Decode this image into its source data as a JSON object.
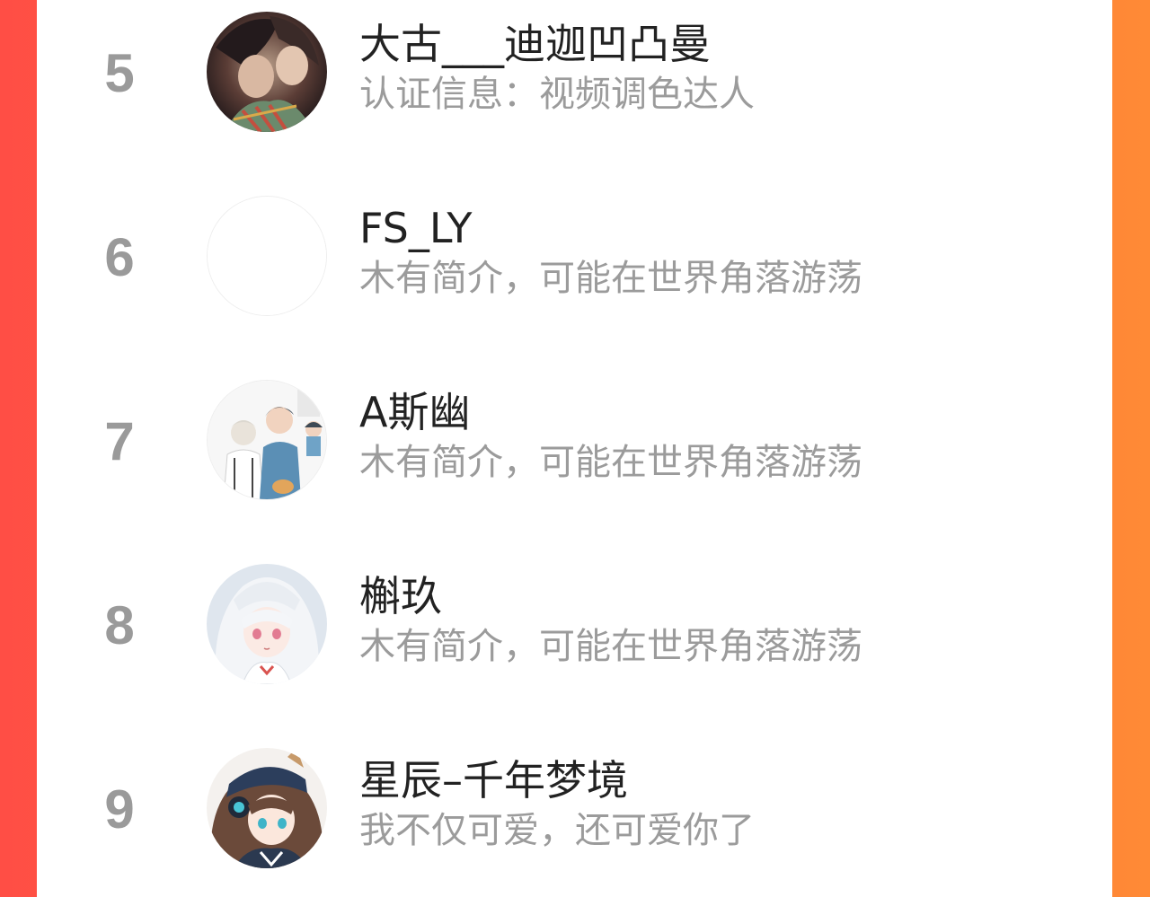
{
  "colors": {
    "background_left": "#ff4e45",
    "background_right": "#ff8a36",
    "panel": "#ffffff",
    "rank_text": "#9a9a9a",
    "name_text": "#222222",
    "bio_text": "#9b9b9b"
  },
  "ranking": {
    "items": [
      {
        "rank": "5",
        "name": "大古___迪迦凹凸曼",
        "bio": "认证信息：视频调色达人",
        "avatar_icon": "anime-avatar-dark-couple"
      },
      {
        "rank": "6",
        "name": "FS_LY",
        "bio": "木有简介，可能在世界角落游荡",
        "avatar_icon": "blank-avatar"
      },
      {
        "rank": "7",
        "name": "A斯幽",
        "bio": "木有简介，可能在世界角落游荡",
        "avatar_icon": "anime-avatar-boys"
      },
      {
        "rank": "8",
        "name": "槲玖",
        "bio": "木有简介，可能在世界角落游荡",
        "avatar_icon": "anime-avatar-white-hair-girl"
      },
      {
        "rank": "9",
        "name": "星辰–千年梦境",
        "bio": "我不仅可爱，还可爱你了",
        "avatar_icon": "anime-avatar-cap-girl"
      }
    ]
  }
}
